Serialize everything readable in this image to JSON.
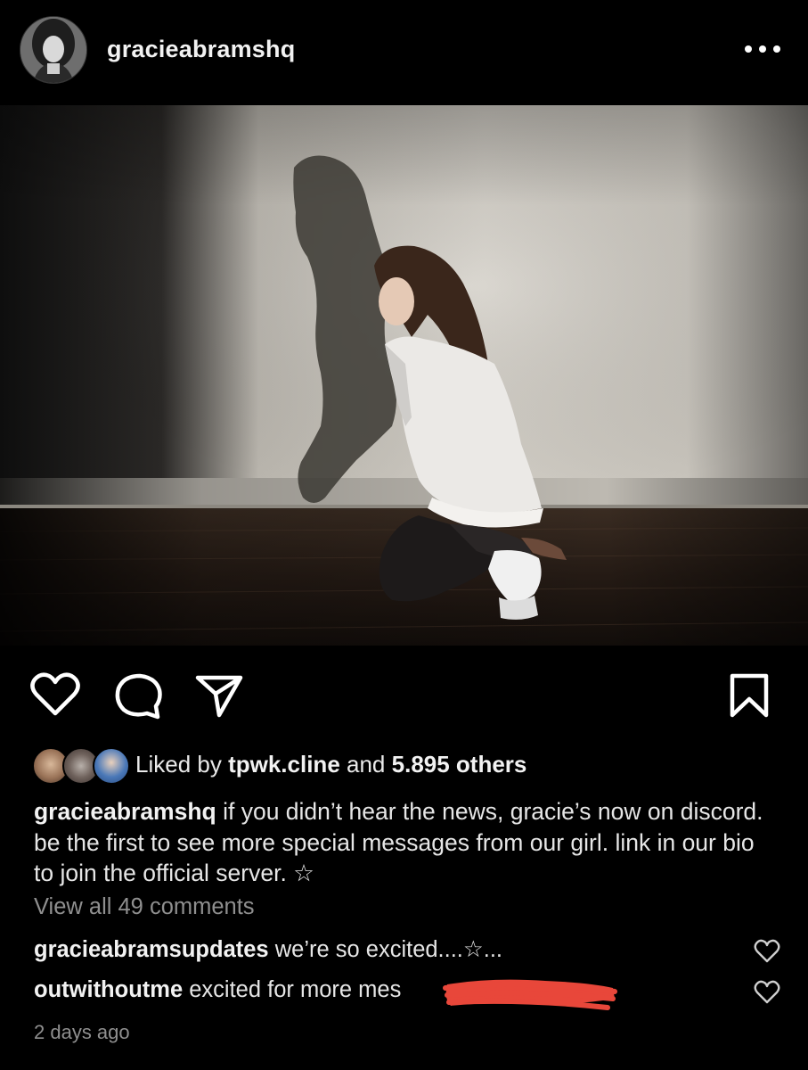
{
  "post": {
    "username": "gracieabramshq",
    "more_icon": "ellipsis-horizontal-icon",
    "photo_icon": "post-photo"
  },
  "actions": {
    "like_icon": "heart-outline-icon",
    "comment_icon": "comment-bubble-icon",
    "share_icon": "paper-plane-icon",
    "save_icon": "bookmark-outline-icon"
  },
  "likes": {
    "prefix": "Liked by",
    "user": "tpwk.cline",
    "joiner": "and",
    "others": "5.895 others"
  },
  "caption": {
    "username": "gracieabramshq",
    "text": "if you didn’t hear the news, gracie’s now on discord. be the first to see more special messages from our girl. link in our bio to join the official server. ☆"
  },
  "comments": {
    "view_all": "View all 49 comments",
    "items": [
      {
        "username": "gracieabramsupdates",
        "text": "we’re so excited....☆..."
      },
      {
        "username": "outwithoutme",
        "text": "excited for more mes"
      }
    ]
  },
  "timestamp": "2 days ago",
  "colors": {
    "background": "#000000",
    "text": "#e6e6e6",
    "muted": "#8f8f8f",
    "redaction": "#e8473a"
  }
}
